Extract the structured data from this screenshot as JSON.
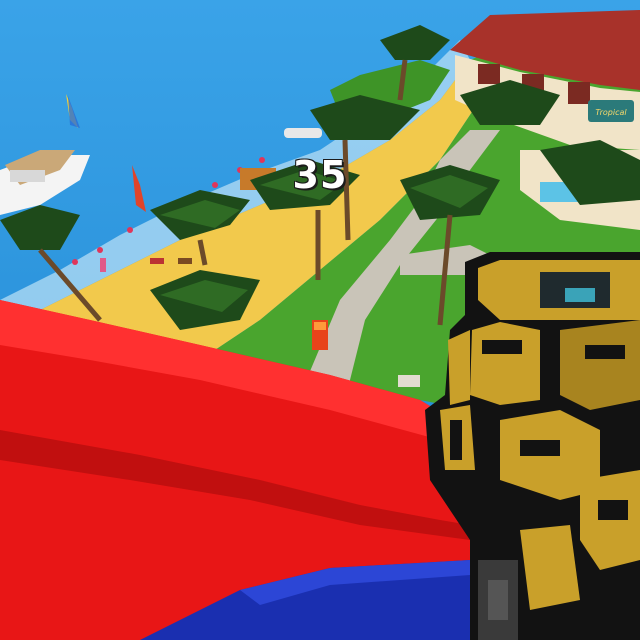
{
  "hud": {
    "ammo_count": "35"
  },
  "scene": {
    "shop_sign": "Tropical",
    "weapon": "gold-pixel-rifle-icon"
  },
  "colors": {
    "sea": "#2a8fd6",
    "sand": "#f2c94c",
    "grass": "#4aa52e",
    "path": "#c9c4b8",
    "red_block": "#e81616",
    "blue_block": "#1a2fb0",
    "weapon_gold": "#c9a02a",
    "weapon_black": "#121212"
  }
}
